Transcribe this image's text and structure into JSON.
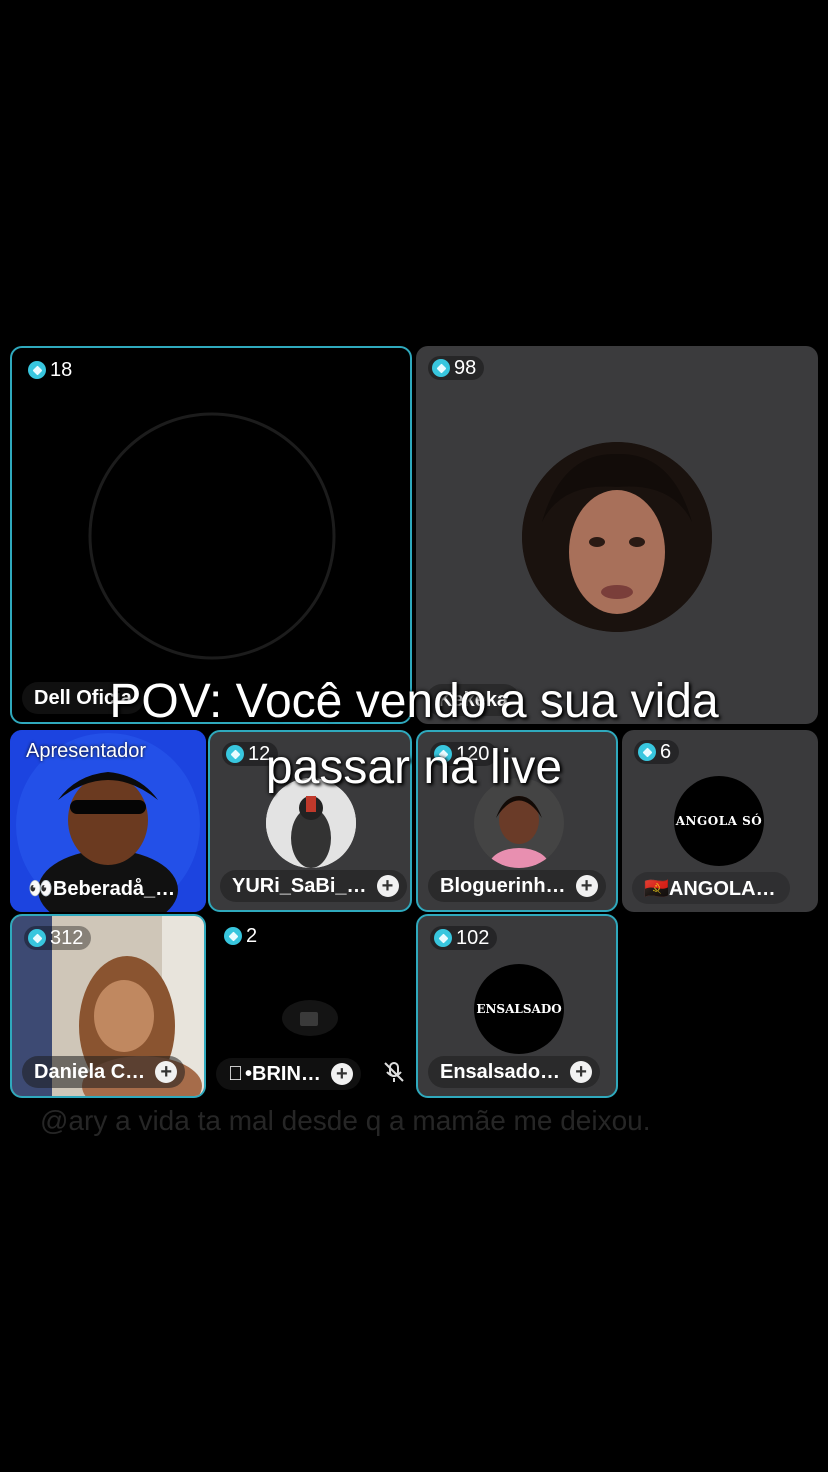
{
  "colors": {
    "accent": "#2fa9bd",
    "gem": "#38c6de",
    "background": "#000000",
    "tile": "#3a3a3c"
  },
  "tiles": {
    "t1": {
      "count": "18",
      "name": "Dell Oficia"
    },
    "t2": {
      "count": "98",
      "name": "Kekeka"
    },
    "t3": {
      "role": "Apresentador",
      "name": "👀Beberadå_…"
    },
    "t4": {
      "count": "12",
      "name": "YURi_SaBi_…"
    },
    "t5": {
      "count": "120",
      "name": "Bloguerinh…"
    },
    "t6": {
      "count": "6",
      "name": "🇦🇴ANGOLA…",
      "logo_text": "ANGOLA SÓ"
    },
    "t7": {
      "count": "312",
      "name": "Daniela C…"
    },
    "t8": {
      "count": "2",
      "name": "•BRIN…",
      "icon": "apple-icon",
      "muted_icon": "mic-off-icon"
    },
    "t9": {
      "count": "102",
      "name": "Ensalsado…",
      "logo_text": "ENSALSADO"
    }
  },
  "overlay": {
    "line1": "POV: Você vendo a sua vida",
    "line2": "passar na live"
  },
  "comment": "@ary a vida ta mal desde q a mamãe me deixou."
}
